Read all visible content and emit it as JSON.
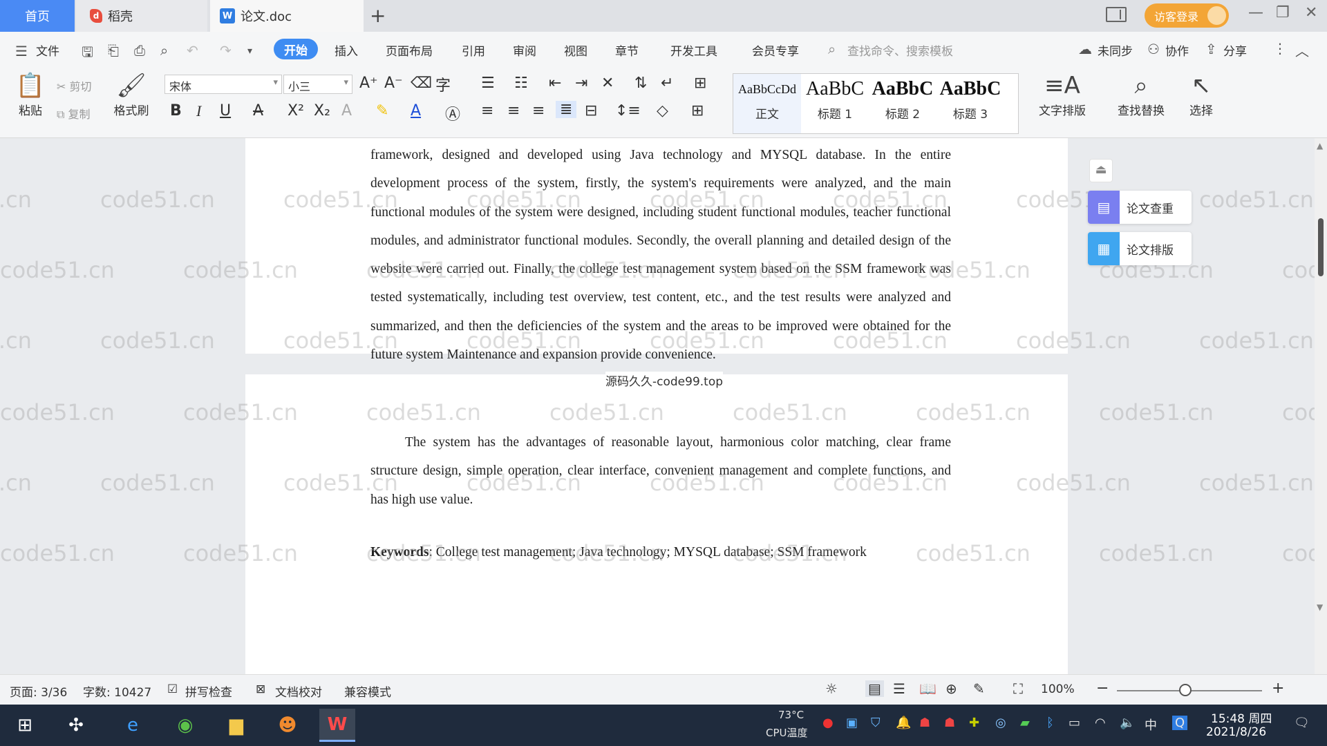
{
  "tabs": {
    "home": "首页",
    "docer": "稻壳",
    "document": "论文.doc",
    "new_tab": "+",
    "login": "访客登录"
  },
  "menu": {
    "file": "文件",
    "items": [
      "开始",
      "插入",
      "页面布局",
      "引用",
      "审阅",
      "视图",
      "章节",
      "开发工具",
      "会员专享"
    ],
    "search_placeholder": "查找命令、搜索模板",
    "unsynced": "未同步",
    "collaborate": "协作",
    "share": "分享"
  },
  "ribbon": {
    "paste": "粘贴",
    "cut": "剪切",
    "copy": "复制",
    "format_painter": "格式刷",
    "font_name": "宋体",
    "font_size": "小三",
    "styles": [
      {
        "preview": "AaBbCcDd",
        "label": "正文"
      },
      {
        "preview": "AaBbC",
        "label": "标题 1"
      },
      {
        "preview": "AaBbC",
        "label": "标题 2"
      },
      {
        "preview": "AaBbC",
        "label": "标题 3"
      }
    ],
    "text_layout": "文字排版",
    "find_replace": "查找替换",
    "select": "选择"
  },
  "document": {
    "abstract": "framework, designed and developed using Java technology and MYSQL database. In the entire development process of the system, firstly, the system's requirements were analyzed, and the main functional modules of the system were designed, including student functional modules, teacher functional modules, and administrator functional modules. Secondly, the overall planning and detailed design of the website were carried out. Finally, the college test management system based on the SSM framework was tested systematically, including test overview, test content, etc., and the test results were analyzed and summarized, and then the deficiencies of the system and the areas to be improved were obtained for the future system Maintenance and expansion provide convenience.",
    "advantages": "The system has the advantages of reasonable layout, harmonious color matching, clear frame structure design, simple operation, clear interface, convenient management and complete functions, and has high use value.",
    "keywords_label": "Keywords",
    "keywords_text": ": College test management; Java technology; MYSQL database; SSM framework",
    "footer_mark": "源码久久-code99.top",
    "watermark": "code51.cn"
  },
  "side_tools": {
    "check": "论文查重",
    "format": "论文排版"
  },
  "status": {
    "page": "页面: 3/36",
    "words": "字数: 10427",
    "spell_check": "拼写检查",
    "proofread": "文档校对",
    "compat": "兼容模式",
    "zoom": "100%"
  },
  "taskbar": {
    "temperature": "73°C",
    "cpu_label": "CPU温度",
    "ime": "中",
    "time": "15:48 周四",
    "date": "2021/8/26"
  }
}
